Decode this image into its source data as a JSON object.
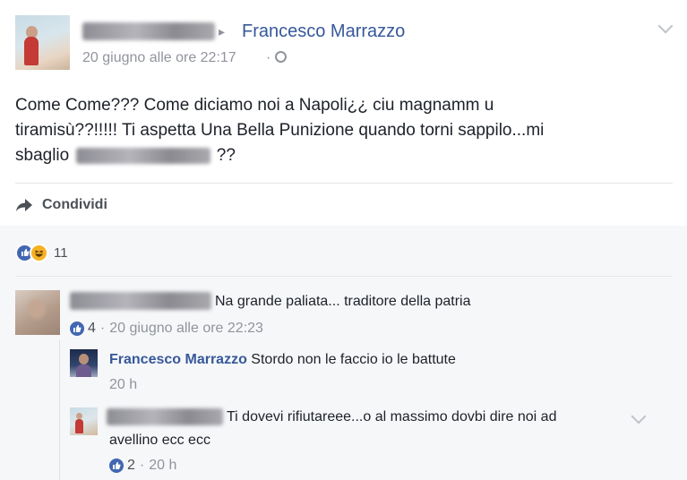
{
  "post": {
    "author_redacted": "Paolo Iobruna",
    "arrow": "▸",
    "target": "Francesco Marrazzo",
    "timestamp": "20 giugno alle ore 22:17",
    "dot": "·",
    "globe": "◷",
    "body_line1": "Come Come??? Come diciamo noi a Napoli¿¿ ciu magnamm u",
    "body_line2": "tiramisù??!!!!! Ti aspetta Una Bella Punizione quando torni sappilo...mi",
    "body_line3_prefix": "sbaglio",
    "body_line3_suffix": "??",
    "share_label": "Condividi",
    "reaction_count": "11"
  },
  "comments": [
    {
      "author_redacted": "Vincenzo Iobruna",
      "text": "Na grande paliata... traditore della patria",
      "likes": "4",
      "sep": "·",
      "time": "20 giugno alle ore 22:23"
    }
  ],
  "replies": [
    {
      "author": "Francesco Marrazzo",
      "text": "Stordo non le faccio io le battute",
      "time": "20 h"
    },
    {
      "author_redacted": "Paolo Iobruna",
      "text_line1": "Ti dovevi rifiutareee...o al massimo dovbi dire noi ad",
      "text_line2": "avellino ecc ecc",
      "likes": "2",
      "sep": "·",
      "time": "20 h"
    }
  ],
  "colors": {
    "link": "#365899",
    "like": "#4267b2",
    "haha": "#f7b125",
    "meta": "#90949c"
  },
  "icons": [
    "chevron-down-icon",
    "share-arrow-icon",
    "like-reaction-icon",
    "haha-reaction-icon",
    "globe-icon"
  ]
}
